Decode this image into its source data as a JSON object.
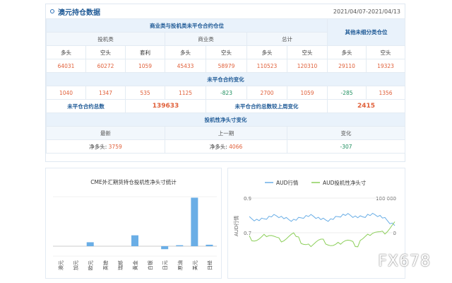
{
  "header": {
    "title": "澳元持仓数据",
    "date_range": "2021/04/07-2021/04/13"
  },
  "table": {
    "group1": "商业类与投机类未平仓合约仓位",
    "group2": "其他未细分类仓位",
    "sub_spec": "投机类",
    "sub_comm": "商业类",
    "sub_total": "总计",
    "cols": [
      "多头",
      "空头",
      "套利",
      "多头",
      "空头",
      "多头",
      "空头",
      "多头",
      "空头"
    ],
    "positions": [
      "64031",
      "60272",
      "1059",
      "45433",
      "58979",
      "110523",
      "120310",
      "29110",
      "19323"
    ],
    "changes_title": "未平仓合约变化",
    "changes": [
      "1040",
      "1347",
      "535",
      "1125",
      "-823",
      "2700",
      "1059",
      "-285",
      "1356"
    ],
    "oi_total_label": "未平仓合约总数",
    "oi_total": "139633",
    "oi_change_label": "未平仓合约总数较上周变化",
    "oi_change": "2415",
    "net_title": "投机性净头寸变化",
    "net_cols": [
      "最新",
      "上一期",
      "变化"
    ],
    "net_latest_label": "净多头:",
    "net_latest": "3759",
    "net_prev_label": "净多头:",
    "net_prev": "4066",
    "net_change": "-307"
  },
  "chart_data": [
    {
      "type": "bar",
      "title": "CME外汇期货持仓投机性净头寸统计",
      "categories": [
        "澳元",
        "加元",
        "欧元",
        "英镑",
        "瑞郎",
        "黄金",
        "白银",
        "日元",
        "原油",
        "美元",
        "日经"
      ],
      "values": [
        0,
        0,
        8,
        0,
        0,
        22,
        0,
        -6,
        2,
        98,
        3
      ],
      "ylim": [
        -20,
        100
      ]
    },
    {
      "type": "line",
      "series": [
        {
          "name": "AUD行情",
          "color": "#6aaee6"
        },
        {
          "name": "AUD投机性净头寸",
          "color": "#8ccf5a"
        }
      ],
      "ylabel": "AUD行情",
      "left_ticks": [
        "0.9",
        "0.7"
      ],
      "right_ticks": [
        "100 000",
        "0"
      ]
    }
  ],
  "watermark": "FX678"
}
